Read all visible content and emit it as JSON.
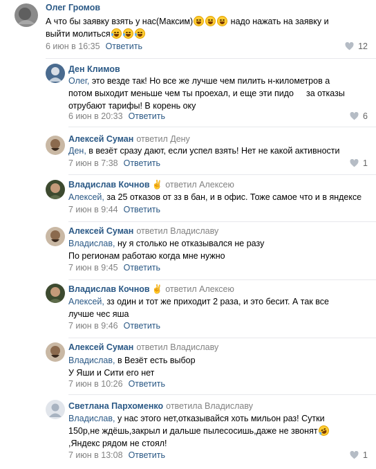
{
  "colors": {
    "link": "#2a5885",
    "meta": "#828282",
    "divider": "#e7e8ec",
    "emoji": "#ffcc33"
  },
  "comments": [
    {
      "author": "Олег Громов",
      "replied_to": "",
      "mention": "",
      "text_lines": [
        "А что бы заявку взять у нас(Максим)",
        "надо нажать на заявку и",
        "выйти молиться"
      ],
      "date": "6 июн в 16:35",
      "reply_label": "Ответить",
      "likes": "12"
    },
    {
      "author": "Ден Климов",
      "replied_to": "",
      "mention": "Олег,",
      "text_lines": [
        " это везде так! Но все же лучше чем пилить н-километров а",
        "потом выходит меньше чем ты проехал, и еще эти пидо",
        "за отказы",
        "отрубают тарифы! В корень оку"
      ],
      "date": "6 июн в 20:33",
      "reply_label": "Ответить",
      "likes": "6"
    },
    {
      "author": "Алексей Суман",
      "replied_to": "ответил Дену",
      "mention": "Ден,",
      "text_lines": [
        " в везёт сразу дают, если успел взять! Нет не какой активности"
      ],
      "date": "7 июн в 7:38",
      "reply_label": "Ответить",
      "likes": "1"
    },
    {
      "author": "Владислав Кочнов",
      "replied_to": "ответил Алексею",
      "mention": "Алексей,",
      "text_lines": [
        " за 25 отказов от зз в бан, и в офис. Тоже самое что и в яндексе"
      ],
      "date": "7 июн в 9:44",
      "reply_label": "Ответить",
      "likes": ""
    },
    {
      "author": "Алексей Суман",
      "replied_to": "ответил Владиславу",
      "mention": "Владислав,",
      "text_lines": [
        " ну я столько не отказывался не разу",
        "По регионам работаю когда мне нужно"
      ],
      "date": "7 июн в 9:45",
      "reply_label": "Ответить",
      "likes": ""
    },
    {
      "author": "Владислав Кочнов",
      "replied_to": "ответил Алексею",
      "mention": "Алексей,",
      "text_lines": [
        " зз один и тот же приходит 2 раза, и это бесит. А так все",
        "лучше чес яша"
      ],
      "date": "7 июн в 9:46",
      "reply_label": "Ответить",
      "likes": ""
    },
    {
      "author": "Алексей Суман",
      "replied_to": "ответил Владиславу",
      "mention": "Владислав,",
      "text_lines": [
        " в Везёт есть выбор",
        "У Яши и Сити его нет"
      ],
      "date": "7 июн в 10:26",
      "reply_label": "Ответить",
      "likes": ""
    },
    {
      "author": "Светлана Пархоменко",
      "replied_to": "ответила Владиславу",
      "mention": "Владислав,",
      "text_lines": [
        " у нас этого нет,отказывайся хоть мильон раз! Сутки",
        "150р,не ждёшь,закрыл и дальше пылесосишь,даже не звонят",
        ",Яндекс рядом не стоял!"
      ],
      "date": "7 июн в 13:08",
      "reply_label": "Ответить",
      "likes": "1"
    }
  ]
}
